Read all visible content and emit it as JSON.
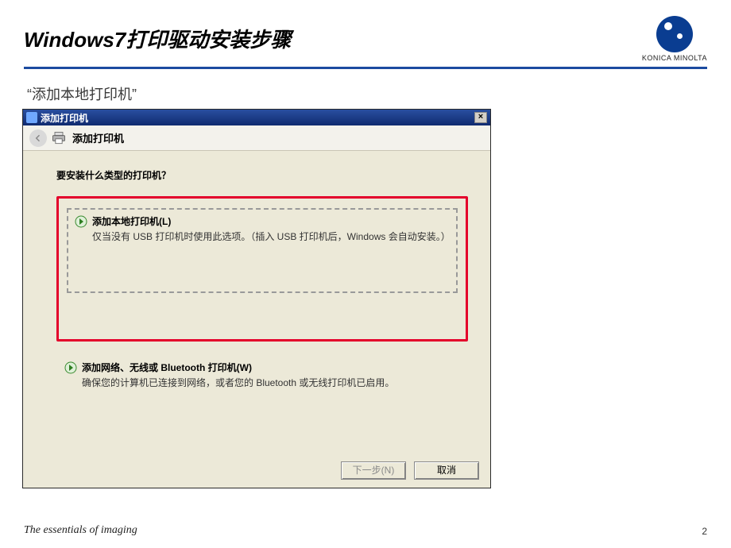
{
  "slide": {
    "title": "Windows7打印驱动安装步骤",
    "subtitle": "“添加本地打印机”",
    "page_number": "2"
  },
  "brand": {
    "name": "KONICA MINOLTA",
    "tagline": "The essentials of imaging"
  },
  "dialog": {
    "window_title": "添加打印机",
    "wizard_header": "添加打印机",
    "question": "要安装什么类型的打印机？",
    "options": [
      {
        "title": "添加本地打印机(L)",
        "description": "仅当没有 USB 打印机时使用此选项。（插入 USB 打印机后，Windows 会自动安装。）",
        "highlighted": true
      },
      {
        "title": "添加网络、无线或 Bluetooth 打印机(W)",
        "description": "确保您的计算机已连接到网络，或者您的 Bluetooth 或无线打印机已启用。",
        "highlighted": false
      }
    ],
    "buttons": {
      "next": "下一步(N)",
      "cancel": "取消",
      "close": "×"
    }
  }
}
